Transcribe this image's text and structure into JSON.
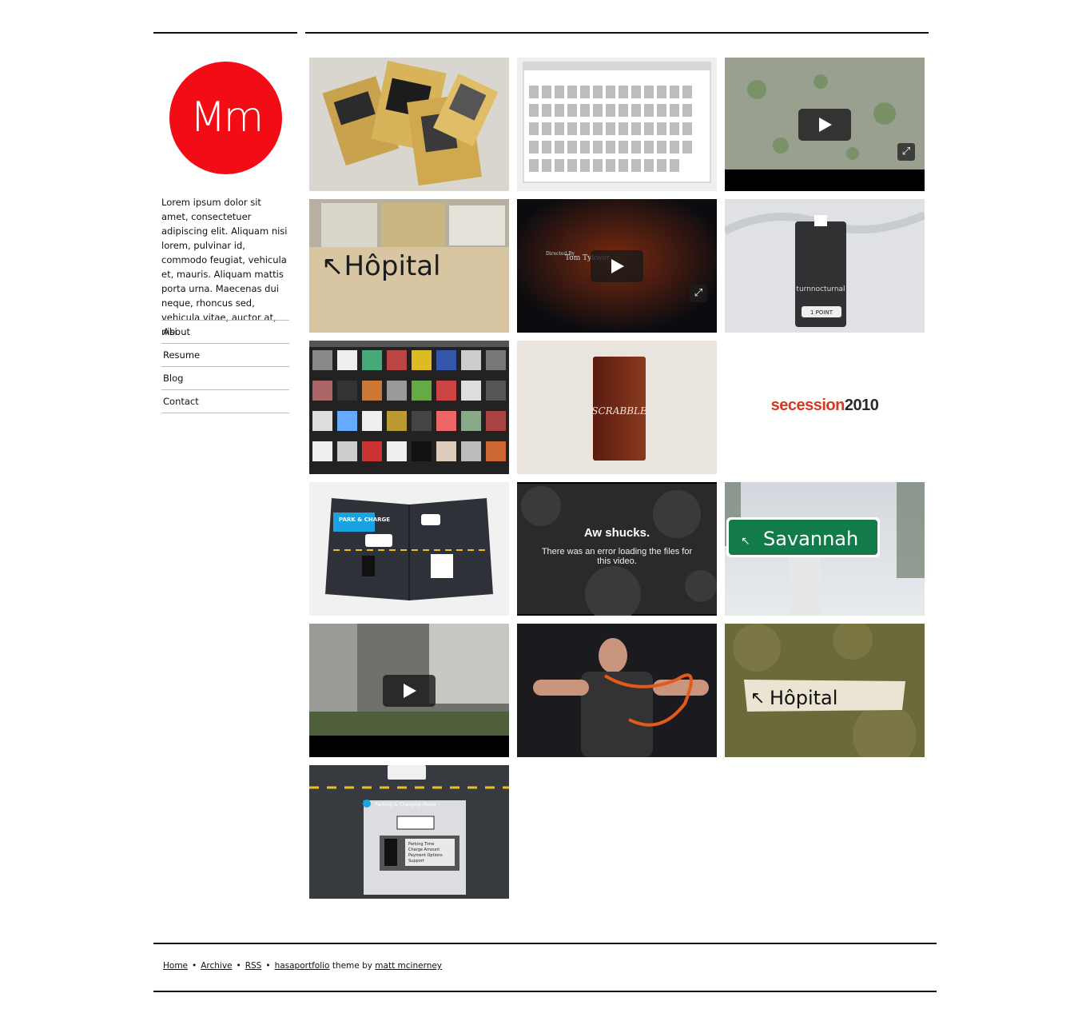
{
  "logo": {
    "text": "Mm",
    "color": "#f20d16"
  },
  "bio": "Lorem ipsum dolor sit amet, consectetuer adipiscing elit. Aliquam nisi lorem, pulvinar id, commodo feugiat, vehicula et, mauris. Aliquam mattis porta urna. Maecenas dui neque, rhoncus sed, vehicula vitae, auctor at, nisi.",
  "nav": [
    {
      "label": "About"
    },
    {
      "label": "Resume"
    },
    {
      "label": "Blog"
    },
    {
      "label": "Contact"
    }
  ],
  "tiles": [
    {
      "kind": "photo",
      "icon": "envelopes-photo"
    },
    {
      "kind": "screenshot",
      "icon": "website-screenshot"
    },
    {
      "kind": "video",
      "icon": "play-icon"
    },
    {
      "kind": "photo",
      "icon": "hopital-newspaper-photo"
    },
    {
      "kind": "video",
      "icon": "play-icon",
      "credit": "Tom Tykwer",
      "credit_prefix": "Directed By"
    },
    {
      "kind": "photo",
      "icon": "tag-photo",
      "tag_text": "turnnocturnal",
      "badge_text": "1 POINT"
    },
    {
      "kind": "screenshot",
      "icon": "album-grid-screenshot"
    },
    {
      "kind": "photo",
      "icon": "scrabble-box-photo",
      "box_text": "SCRABBLE"
    },
    {
      "kind": "logo",
      "icon": "secession-logo",
      "text_a": "secession",
      "text_b": "2010"
    },
    {
      "kind": "photo",
      "icon": "park-charge-brochure",
      "label": "PARK & CHARGE"
    },
    {
      "kind": "video-error",
      "title": "Aw shucks.",
      "message": "There was an error loading the files for this video."
    },
    {
      "kind": "photo",
      "icon": "savannah-sign-photo",
      "sign_text": "Savannah"
    },
    {
      "kind": "video",
      "icon": "play-icon"
    },
    {
      "kind": "photo",
      "icon": "man-with-cord-photo"
    },
    {
      "kind": "photo",
      "icon": "hopital-grass-photo",
      "sign_text": "Hôpital"
    },
    {
      "kind": "photo",
      "icon": "parking-meter-photo",
      "meter_title": "Parking & Charging Meter",
      "meter_items": [
        "Parking Time",
        "Charge Amount",
        "Payment Options",
        "Support"
      ]
    }
  ],
  "footer": {
    "home": "Home",
    "archive": "Archive",
    "rss": "RSS",
    "theme": "hasaportfolio",
    "theme_by": "theme by",
    "author": "matt mcinerney",
    "separator": "•"
  }
}
